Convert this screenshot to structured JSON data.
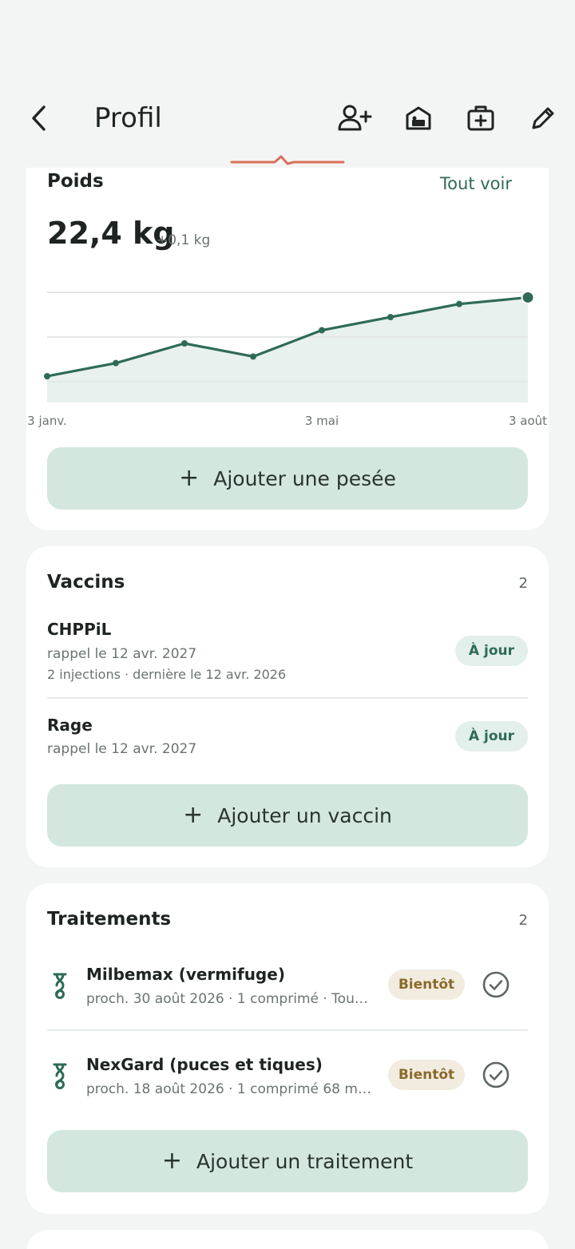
{
  "header": {
    "title": "Profil",
    "icons": [
      "back-icon",
      "add-person-icon",
      "kennel-icon",
      "medical-kit-icon",
      "edit-icon"
    ]
  },
  "weight": {
    "title": "Poids",
    "link": "Tout voir",
    "value": "22,4 kg",
    "delta": "+0,1 kg",
    "add_label": "Ajouter une pesée",
    "colors": {
      "line": "#2e6b57",
      "fill": "#e8f1ed"
    }
  },
  "chart_data": {
    "type": "line",
    "x_tick_labels": [
      "3 janv.",
      "3 mai",
      "3 août"
    ],
    "series": [
      {
        "values": [
          21.9,
          22.0,
          22.15,
          22.05,
          22.25,
          22.35,
          22.45,
          22.5
        ]
      }
    ],
    "ylim": [
      21.7,
      22.6
    ],
    "grid": true
  },
  "vaccines": {
    "title": "Vaccins",
    "count": "2",
    "items": [
      {
        "name": "CHPPiL",
        "sub": "rappel le 12 avr. 2027",
        "sub2": "2 injections · dernière le 12 avr. 2026",
        "status": "À jour"
      },
      {
        "name": "Rage",
        "sub": "rappel le 12 avr. 2027",
        "status": "À jour"
      }
    ],
    "add_label": "Ajouter un vaccin"
  },
  "treatments": {
    "title": "Traitements",
    "count": "2",
    "items": [
      {
        "name": "Milbemax (vermifuge)",
        "sub": "proch. 30 août 2026 · 1 comprimé · Tou…",
        "status": "Bientôt"
      },
      {
        "name": "NexGard (puces et tiques)",
        "sub": "proch. 18 août 2026 · 1 comprimé 68 m…",
        "status": "Bientôt"
      }
    ],
    "add_label": "Ajouter un traitement"
  }
}
